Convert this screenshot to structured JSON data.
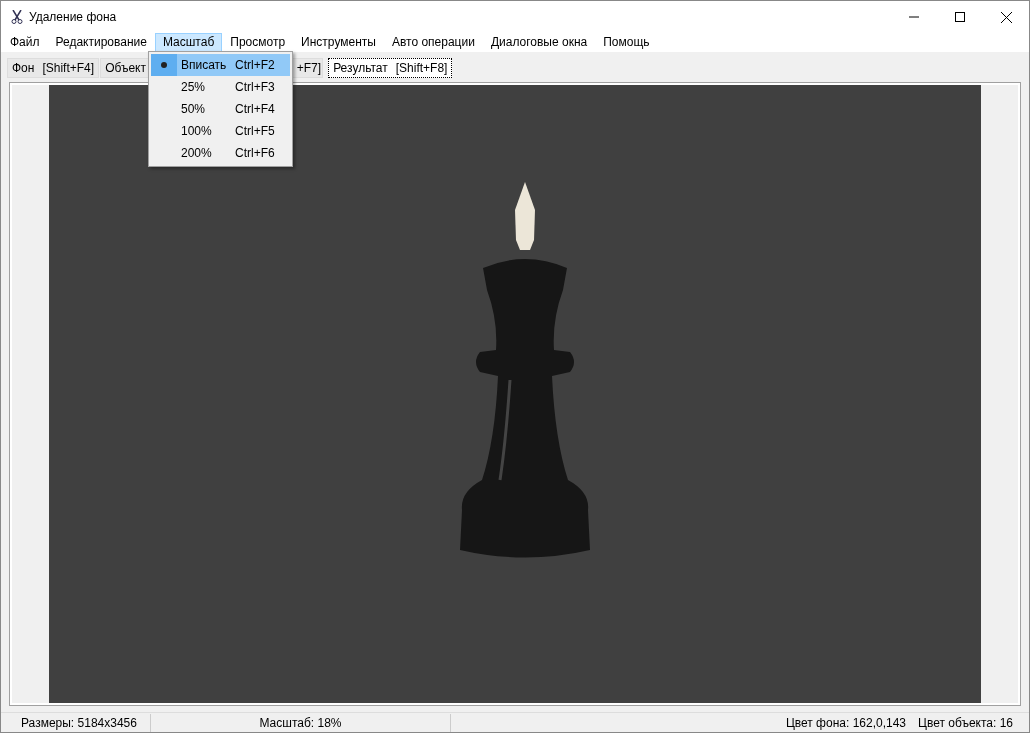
{
  "window": {
    "title": "Удаление фона"
  },
  "menu": [
    {
      "label": "Файл",
      "selected": false
    },
    {
      "label": "Редактирование",
      "selected": false
    },
    {
      "label": "Масштаб",
      "selected": true
    },
    {
      "label": "Просмотр",
      "selected": false
    },
    {
      "label": "Инструменты",
      "selected": false
    },
    {
      "label": "Авто операции",
      "selected": false
    },
    {
      "label": "Диалоговые окна",
      "selected": false
    },
    {
      "label": "Помощь",
      "selected": false
    }
  ],
  "dropdown": [
    {
      "label": "Вписать",
      "shortcut": "Ctrl+F2",
      "checked": true,
      "selected": true
    },
    {
      "label": "25%",
      "shortcut": "Ctrl+F3",
      "checked": false,
      "selected": false
    },
    {
      "label": "50%",
      "shortcut": "Ctrl+F4",
      "checked": false,
      "selected": false
    },
    {
      "label": "100%",
      "shortcut": "Ctrl+F5",
      "checked": false,
      "selected": false
    },
    {
      "label": "200%",
      "shortcut": "Ctrl+F6",
      "checked": false,
      "selected": false
    }
  ],
  "tabs": [
    {
      "label": "Фон",
      "shortcut": "[Shift+F4]",
      "selected": false
    },
    {
      "label": "Объект",
      "selected": false
    },
    {
      "shortcut": "+F7]",
      "selected": false
    },
    {
      "label": "Результат",
      "shortcut": "[Shift+F8]",
      "selected": true
    }
  ],
  "status_bar": {
    "size": "Размеры: 5184x3456",
    "zoom": "Масштаб: 18%",
    "bg_color": "Цвет фона: 162,0,143",
    "obj_color": "Цвет объекта: 16"
  }
}
